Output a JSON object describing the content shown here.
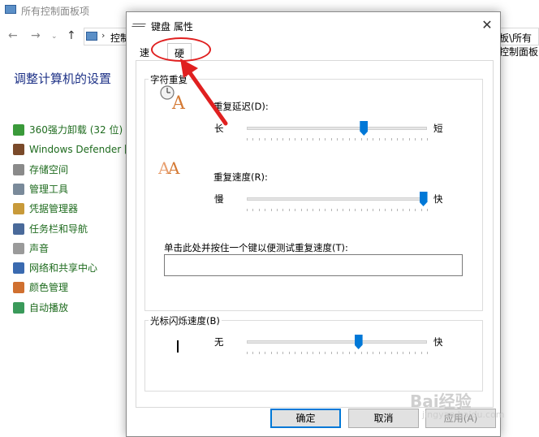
{
  "background_window": {
    "title": "所有控制面板项",
    "address_path": "控制",
    "address_right": "板\\所有控制面板",
    "heading": "调整计算机的设置",
    "items": [
      {
        "label": "360强力卸载 (32 位)",
        "color": "#3a9a3a"
      },
      {
        "label": "Windows Defender 防",
        "color": "#7a4a2a"
      },
      {
        "label": "存储空间",
        "color": "#8a8a8a"
      },
      {
        "label": "管理工具",
        "color": "#7a8a9a"
      },
      {
        "label": "凭据管理器",
        "color": "#c89a3a"
      },
      {
        "label": "任务栏和导航",
        "color": "#4a6a9a"
      },
      {
        "label": "声音",
        "color": "#9a9a9a"
      },
      {
        "label": "网络和共享中心",
        "color": "#3a6ab0"
      },
      {
        "label": "颜色管理",
        "color": "#d07030"
      },
      {
        "label": "自动播放",
        "color": "#3a9a5a"
      }
    ],
    "right_paren": ")"
  },
  "dialog": {
    "title": "键盘 属性",
    "close_symbol": "✕",
    "tabs": [
      {
        "label": "速度",
        "selected": false
      },
      {
        "label": "硬件",
        "selected": true
      }
    ],
    "repeat_group": {
      "title": "字符重复",
      "delay": {
        "label": "重复延迟(D):",
        "min_label": "长",
        "max_label": "短",
        "value_fraction": 0.65
      },
      "rate": {
        "label": "重复速度(R):",
        "min_label": "慢",
        "max_label": "快",
        "value_fraction": 0.98
      },
      "test_label": "单击此处并按住一个键以便测试重复速度(T):",
      "test_value": ""
    },
    "cursor_group": {
      "title": "光标闪烁速度(B)",
      "min_label": "无",
      "max_label": "快",
      "value_fraction": 0.62
    },
    "buttons": {
      "ok": "确定",
      "cancel": "取消",
      "apply": "应用(A)"
    }
  },
  "watermark": {
    "text": "Bai经验",
    "sub": "jingyan.baidu.com"
  },
  "colors": {
    "accent": "#0078d7",
    "annotation": "#e02020",
    "link_green": "#1e6b1e",
    "heading_blue": "#1e3287"
  }
}
